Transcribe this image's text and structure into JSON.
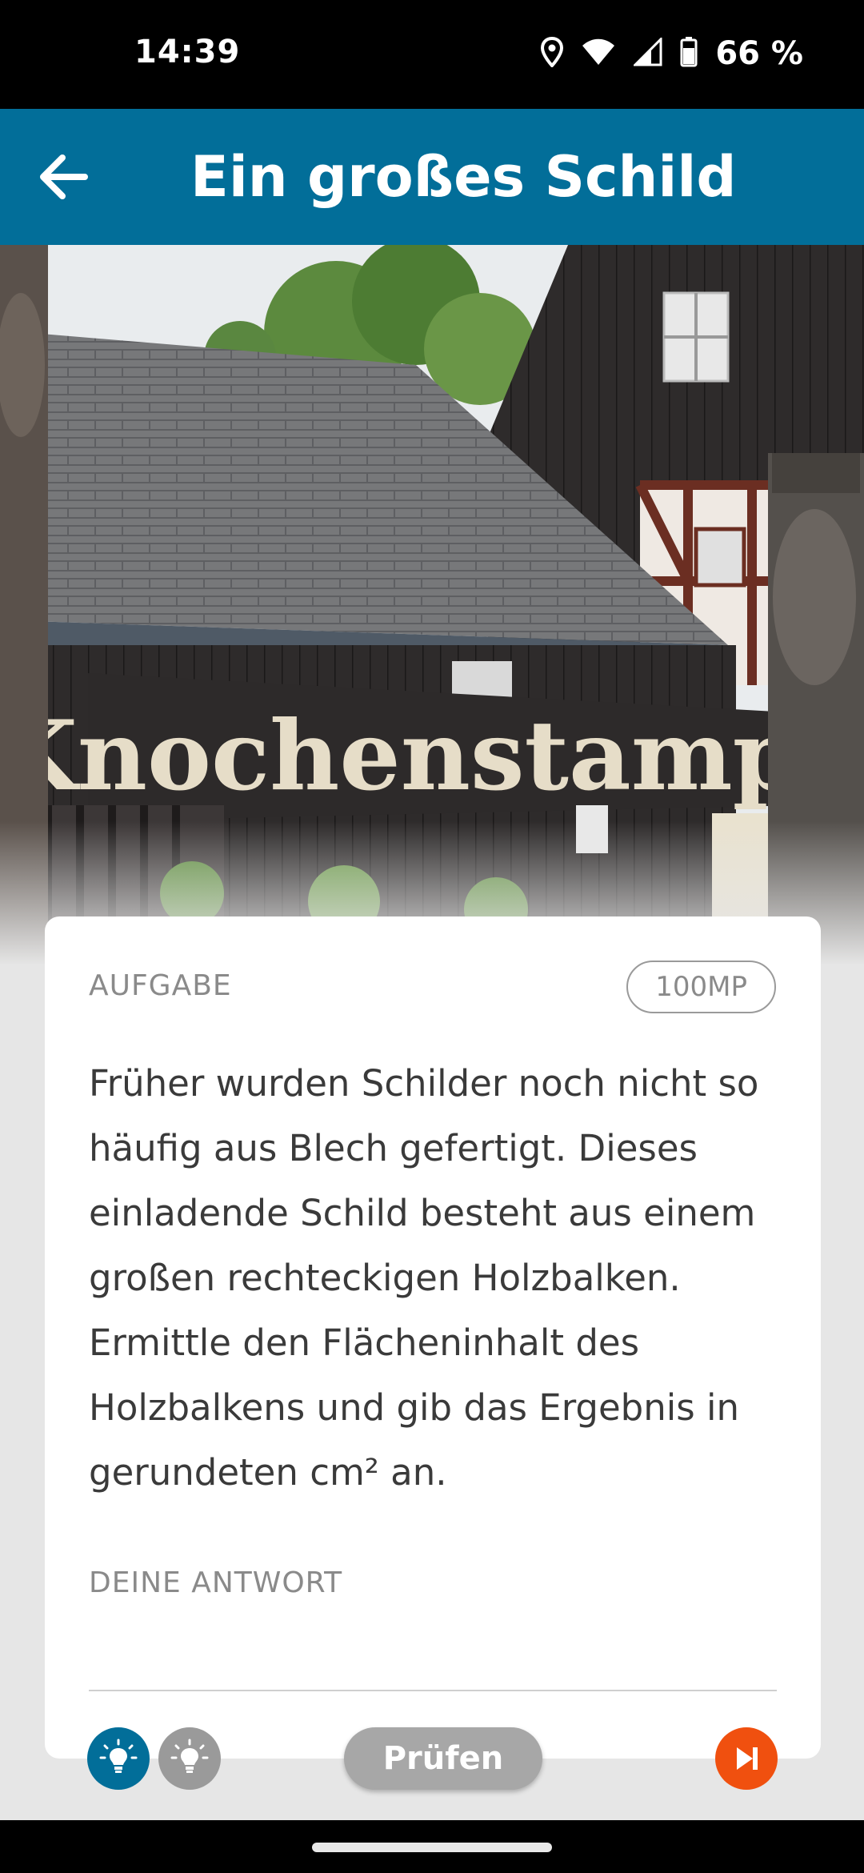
{
  "status_bar": {
    "time": "14:39",
    "battery_text": "66 %",
    "icons": [
      "location-icon",
      "wifi-icon",
      "signal-icon",
      "battery-icon"
    ]
  },
  "app_bar": {
    "back_icon": "arrow-left-icon",
    "title": "Ein großes Schild"
  },
  "photo": {
    "sign_text": "Knochenstampfe"
  },
  "card": {
    "task_label": "AUFGABE",
    "points": "100MP",
    "task_text": "Früher wurden Schilder noch nicht so häufig aus Blech gefertigt. Dieses einladende Schild besteht aus einem großen rechteckigen Holzbalken. Ermittle den Flächeninhalt des Holzbalkens und gib das Ergebnis in gerundeten cm² an.",
    "answer_label": "DEINE ANTWORT",
    "answer_value": ""
  },
  "controls": {
    "hint1_icon": "lightbulb-icon",
    "hint2_icon": "lightbulb-icon",
    "check_label": "Prüfen",
    "skip_icon": "skip-next-icon"
  },
  "colors": {
    "primary": "#026e99",
    "accent": "#f0500f",
    "disabled": "#a7a7a7"
  }
}
